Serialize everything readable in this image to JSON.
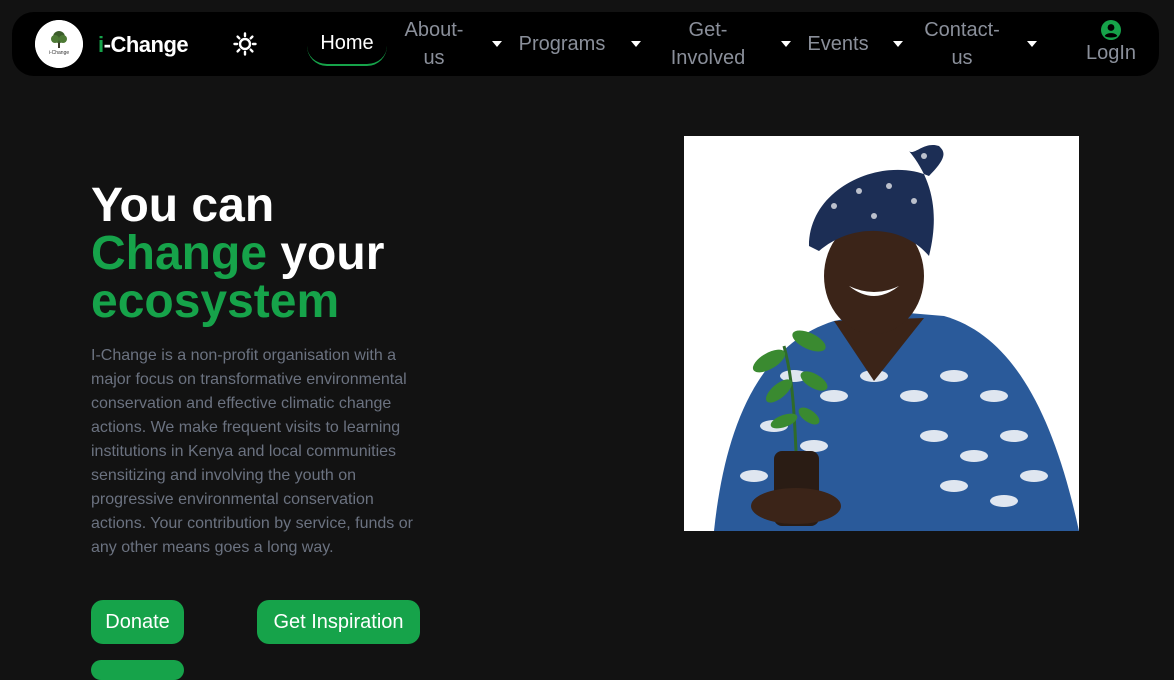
{
  "nav": {
    "brand_prefix": "i",
    "brand_rest": "-Change",
    "logo_text": "i-Change",
    "items": [
      {
        "label": "Home"
      },
      {
        "label": "About-\nus"
      },
      {
        "label": "Programs"
      },
      {
        "label": "Get-\nInvolved"
      },
      {
        "label": "Events"
      },
      {
        "label": "Contact-\nus"
      }
    ],
    "login_label": "LogIn",
    "icons": {
      "theme": "sun-icon",
      "login": "user-circle-icon",
      "dropdown": "caret-down-icon"
    }
  },
  "hero": {
    "line1": "You can",
    "word_change": "Change",
    "word_your": " your",
    "word_ecosystem": "ecosystem",
    "description": "I-Change is a non-profit organisation with a major focus on transformative environmental conservation and effective climatic change actions. We make frequent visits to learning institutions in Kenya and local communities sensitizing and involving the youth on progressive environmental conservation actions. Your contribution by service, funds or any other means goes a long way.",
    "buttons": {
      "donate": "Donate",
      "inspiration": "Get Inspiration"
    }
  },
  "colors": {
    "accent": "#16a34a",
    "background": "#121212",
    "nav_bg": "#000000",
    "muted_text": "#6b7280"
  }
}
